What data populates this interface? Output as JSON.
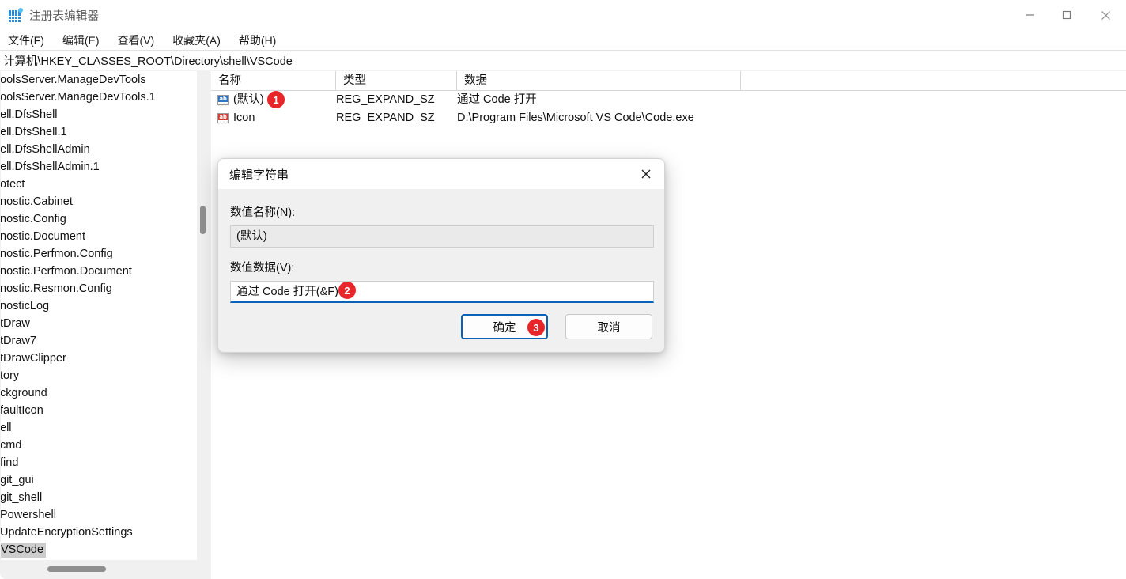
{
  "window": {
    "title": "注册表编辑器",
    "icon": "registry-editor-icon",
    "controls": {
      "minimize": "minimize-icon",
      "maximize": "maximize-icon",
      "close": "close-icon"
    }
  },
  "menubar": {
    "items": [
      {
        "label": "文件(F)"
      },
      {
        "label": "编辑(E)"
      },
      {
        "label": "查看(V)"
      },
      {
        "label": "收藏夹(A)"
      },
      {
        "label": "帮助(H)"
      }
    ]
  },
  "addressbar": {
    "path": "计算机\\HKEY_CLASSES_ROOT\\Directory\\shell\\VSCode"
  },
  "tree": {
    "items": [
      {
        "label": "oolsServer.ManageDevTools",
        "selected": false
      },
      {
        "label": "oolsServer.ManageDevTools.1",
        "selected": false
      },
      {
        "label": "ell.DfsShell",
        "selected": false
      },
      {
        "label": "ell.DfsShell.1",
        "selected": false
      },
      {
        "label": "ell.DfsShellAdmin",
        "selected": false
      },
      {
        "label": "ell.DfsShellAdmin.1",
        "selected": false
      },
      {
        "label": "otect",
        "selected": false
      },
      {
        "label": "nostic.Cabinet",
        "selected": false
      },
      {
        "label": "nostic.Config",
        "selected": false
      },
      {
        "label": "nostic.Document",
        "selected": false
      },
      {
        "label": "nostic.Perfmon.Config",
        "selected": false
      },
      {
        "label": "nostic.Perfmon.Document",
        "selected": false
      },
      {
        "label": "nostic.Resmon.Config",
        "selected": false
      },
      {
        "label": "nosticLog",
        "selected": false
      },
      {
        "label": "tDraw",
        "selected": false
      },
      {
        "label": "tDraw7",
        "selected": false
      },
      {
        "label": "tDrawClipper",
        "selected": false
      },
      {
        "label": "tory",
        "selected": false
      },
      {
        "label": "ckground",
        "selected": false
      },
      {
        "label": "faultIcon",
        "selected": false
      },
      {
        "label": "ell",
        "selected": false
      },
      {
        "label": "cmd",
        "selected": false
      },
      {
        "label": "find",
        "selected": false
      },
      {
        "label": "git_gui",
        "selected": false
      },
      {
        "label": "git_shell",
        "selected": false
      },
      {
        "label": "Powershell",
        "selected": false
      },
      {
        "label": "UpdateEncryptionSettings",
        "selected": false
      },
      {
        "label": "VSCode",
        "selected": true
      }
    ]
  },
  "listview": {
    "columns": [
      "名称",
      "类型",
      "数据"
    ],
    "rows": [
      {
        "icon": "string-value-icon",
        "icon_color": "blue",
        "name": "(默认)",
        "type": "REG_EXPAND_SZ",
        "data": "通过 Code 打开"
      },
      {
        "icon": "string-value-icon",
        "icon_color": "red",
        "name": "Icon",
        "type": "REG_EXPAND_SZ",
        "data": "D:\\Program Files\\Microsoft VS Code\\Code.exe"
      }
    ]
  },
  "dialog": {
    "title": "编辑字符串",
    "close_icon": "close-icon",
    "name_label": "数值名称(N):",
    "name_value": "(默认)",
    "data_label": "数值数据(V):",
    "data_value": "通过 Code 打开(&F)",
    "ok_label": "确定",
    "cancel_label": "取消"
  },
  "annotations": {
    "badge1": "1",
    "badge2": "2",
    "badge3": "3",
    "color": "#e8262a"
  }
}
